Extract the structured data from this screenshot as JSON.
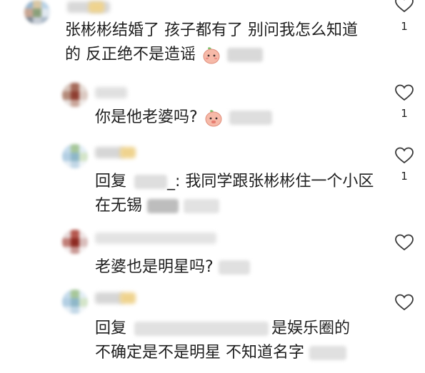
{
  "comments": [
    {
      "text_line1": "张彬彬结婚了 孩子都有了 别问我怎么知道",
      "text_line2": "的 反正绝不是造谣",
      "likes": "1"
    },
    {
      "text_line1": "你是他老婆吗?",
      "likes": "1"
    },
    {
      "reply_prefix": "回复",
      "text_line1_suffix": "_: 我同学跟张彬彬住一个小区",
      "text_line2": "在无锡",
      "likes": "1"
    },
    {
      "text_line1": "老婆也是明星吗?",
      "likes": ""
    },
    {
      "reply_prefix": "回复",
      "text_line1_suffix": "是娱乐圈的",
      "text_line2": "不确定是不是明星 不知道名字",
      "likes": ""
    }
  ],
  "colors": {
    "heart_stroke": "#3a3a3a",
    "text": "#1f1f1f",
    "emoji_face": "#f6b9a8"
  },
  "icons": [
    "heart-outline-icon",
    "peach-emoji-icon",
    "avatar-mosaic"
  ]
}
